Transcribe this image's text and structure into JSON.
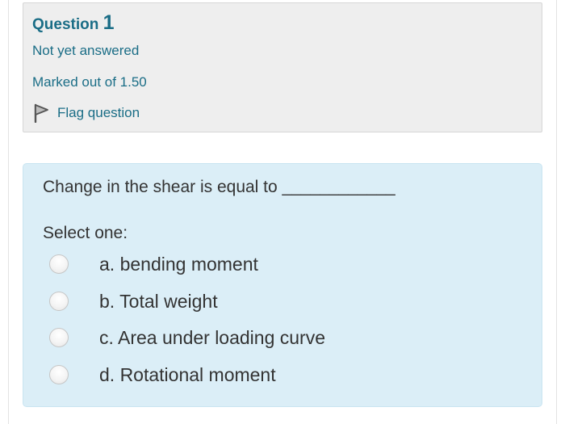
{
  "info": {
    "question_word": "Question",
    "question_number": "1",
    "state": "Not yet answered",
    "grade": "Marked out of 1.50",
    "flag_label": "Flag question",
    "flag_icon": "flag-icon"
  },
  "question": {
    "text": "Change in the shear is equal to ____________",
    "prompt": "Select one:",
    "options": [
      {
        "label": "a. bending moment",
        "selected": false
      },
      {
        "label": "b. Total weight",
        "selected": false
      },
      {
        "label": "c. Area under loading curve",
        "selected": false
      },
      {
        "label": "d. Rotational moment",
        "selected": false
      }
    ]
  },
  "colors": {
    "accent": "#1a6d86",
    "info_background": "#eeeeee",
    "content_background": "#dbeef7",
    "text": "#333333"
  }
}
